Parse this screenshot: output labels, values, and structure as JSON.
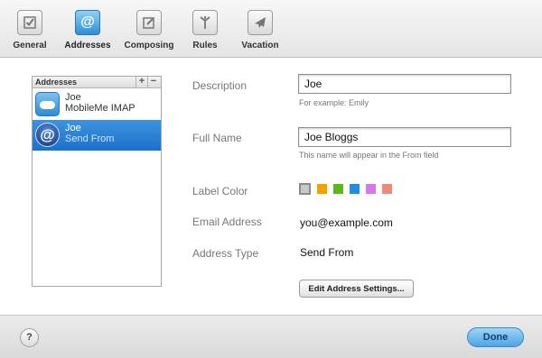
{
  "toolbar": {
    "items": [
      {
        "label": "General",
        "icon": "checkbox-icon"
      },
      {
        "label": "Addresses",
        "icon": "at-sign-icon"
      },
      {
        "label": "Composing",
        "icon": "pencil-square-icon"
      },
      {
        "label": "Rules",
        "icon": "split-arrow-icon"
      },
      {
        "label": "Vacation",
        "icon": "airplane-icon"
      }
    ],
    "active": "Addresses"
  },
  "addresses": {
    "header": "Addresses",
    "add_glyph": "+",
    "remove_glyph": "−",
    "rows": [
      {
        "name": "Joe",
        "sub": "MobileMe IMAP",
        "icon": "cloud-icon",
        "selected": false
      },
      {
        "name": "Joe",
        "sub": "Send From",
        "icon": "at-sign-icon",
        "selected": true
      }
    ]
  },
  "form": {
    "description_label": "Description",
    "description_value": "Joe",
    "description_hint": "For example: Emily",
    "fullname_label": "Full Name",
    "fullname_value": "Joe Bloggs",
    "fullname_hint": "This name will appear in the From field",
    "labelcolor_label": "Label Color",
    "label_colors": [
      "#c8c8c8",
      "#f5a000",
      "#5bb81a",
      "#1e8fe0",
      "#d678e8",
      "#f08878"
    ],
    "email_label": "Email Address",
    "email_value": "you@example.com",
    "type_label": "Address Type",
    "type_value": "Send From",
    "settings_button": "Edit Address Settings..."
  },
  "footer": {
    "help_glyph": "?",
    "done_label": "Done"
  },
  "colors": {
    "accent": "#1a72cb",
    "done_button": "#4da4e6"
  }
}
